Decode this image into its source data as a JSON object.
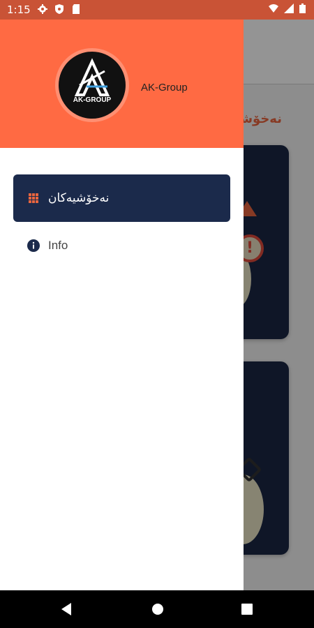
{
  "status_bar": {
    "time": "1:15",
    "left_icons": [
      "gear-icon",
      "shield-icon",
      "sd-card-icon"
    ],
    "right_icons": [
      "wifi-icon",
      "signal-icon",
      "battery-icon"
    ],
    "color": "#c95336"
  },
  "background": {
    "section_title": "نەخۆشی"
  },
  "drawer": {
    "header_color": "#ff6a43",
    "logo_text": "AK-GROUP",
    "brand_name": "AK-Group",
    "items": [
      {
        "label": "نەخۆشیەکان",
        "icon": "grid-icon",
        "selected": true
      },
      {
        "label": "Info",
        "icon": "info-icon",
        "selected": false
      }
    ],
    "selected_color": "#1b2a4b"
  },
  "nav_bar": {
    "buttons": [
      "back-icon",
      "home-icon",
      "recents-icon"
    ]
  }
}
